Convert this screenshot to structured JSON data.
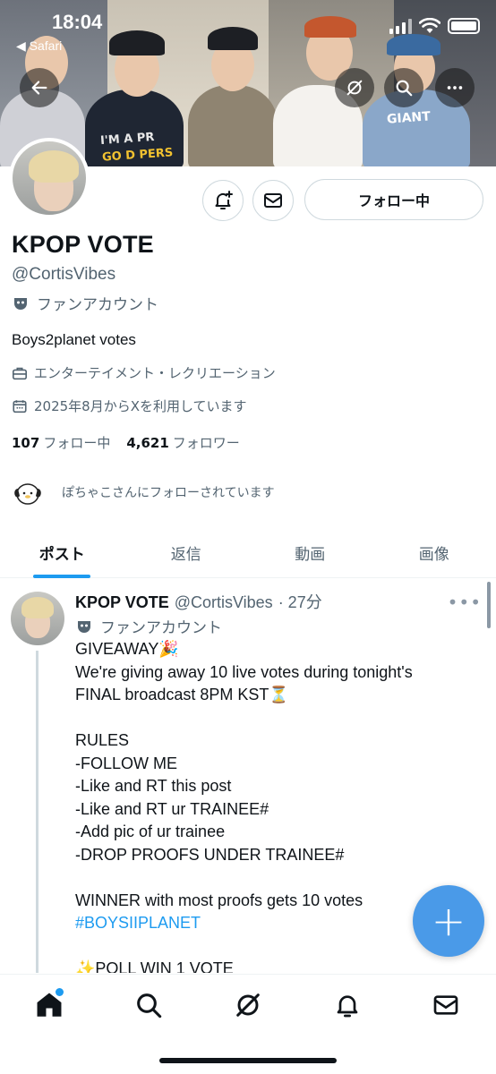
{
  "status_bar": {
    "time": "18:04",
    "back_app": "◀ Safari",
    "icons": [
      "signal-icon",
      "wifi-icon",
      "battery-icon"
    ]
  },
  "header_buttons": [
    "back-arrow-icon",
    "grok-icon",
    "search-icon",
    "more-icon"
  ],
  "banner": {
    "shirt_text_1": "I'M A PR",
    "shirt_text_2": "GO D PERS",
    "shirt_text_3": "GIANT"
  },
  "profile": {
    "name": "KPOP VOTE",
    "handle": "@CortisVibes",
    "label": "ファンアカウント",
    "bio": "Boys2planet votes",
    "category": "エンターテイメント・レクリエーション",
    "joined": "2025年8月からXを利用しています",
    "following_count": "107",
    "following_label": "フォロー中",
    "followers_count": "4,621",
    "followers_label": "フォロワー",
    "followed_by": "ぽちゃこさんにフォローされています",
    "follow_button": "フォロー中"
  },
  "tabs": [
    {
      "label": "ポスト",
      "active": true
    },
    {
      "label": "返信",
      "active": false
    },
    {
      "label": "動画",
      "active": false
    },
    {
      "label": "画像",
      "active": false
    }
  ],
  "tweet": {
    "name": "KPOP VOTE",
    "handle": "@CortisVibes",
    "time": "· 27分",
    "label": "ファンアカウント",
    "lines": [
      "GIVEAWAY🎉",
      "We're giving away 10 live votes during tonight's",
      "FINAL broadcast 8PM KST⏳",
      "",
      "RULES",
      "-FOLLOW ME",
      "-Like and RT this post",
      "-Like and RT ur TRAINEE#",
      "-Add pic of ur trainee",
      "-DROP PROOFS UNDER TRAINEE#",
      "",
      "WINNER with most proofs gets 10 votes"
    ],
    "hashtag": "#BOYSIIPLANET",
    "partial_line": "✨POLL WIN 1 VOTE"
  },
  "fab": {
    "label": "+"
  },
  "bottom_nav": [
    "home-icon",
    "search-icon",
    "grok-icon",
    "notifications-icon",
    "messages-icon"
  ],
  "colors": {
    "accent": "#1d9bf0",
    "text": "#0f1419",
    "secondary": "#536471",
    "fab": "#4a9ae8"
  }
}
